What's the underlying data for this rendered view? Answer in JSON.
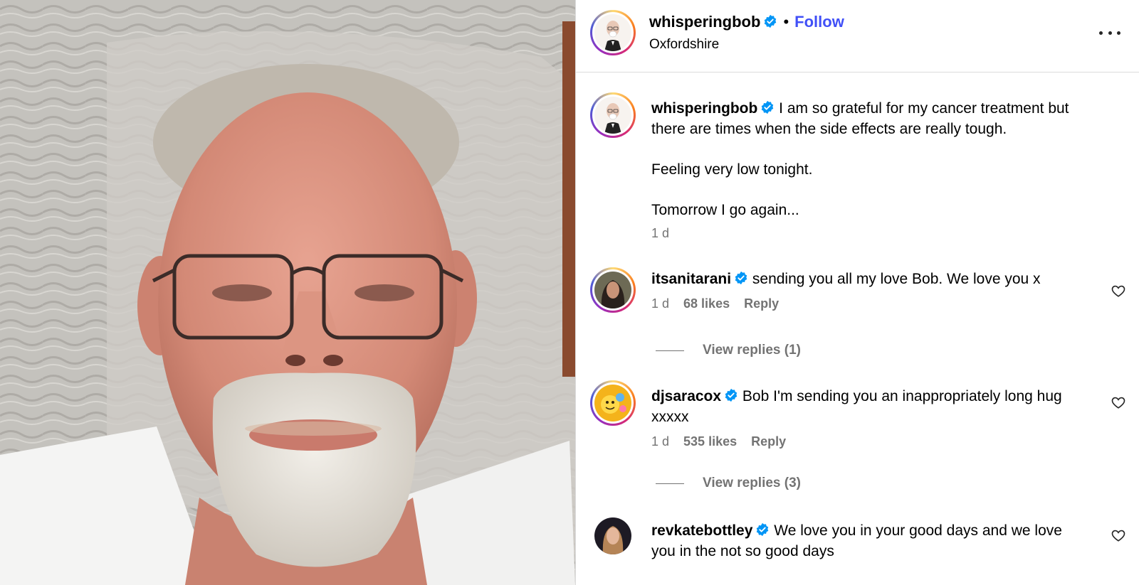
{
  "post": {
    "author": "whisperingbob",
    "follow_label": "Follow",
    "separator": "•",
    "location": "Oxfordshire",
    "caption": {
      "username": "whisperingbob",
      "line1": "I am so grateful for my cancer treatment but there are times when the side effects are really tough.",
      "line2": "Feeling very low tonight.",
      "line3": "Tomorrow I go again...",
      "time": "1 d"
    }
  },
  "comments": [
    {
      "username": "itsanitarani",
      "text": "sending you all my love Bob. We love you x",
      "time": "1 d",
      "likes": "68 likes",
      "reply_label": "Reply",
      "view_replies": "View replies (1)"
    },
    {
      "username": "djsaracox",
      "text": "Bob I'm sending you an inappropriately long hug xxxxx",
      "time": "1 d",
      "likes": "535 likes",
      "reply_label": "Reply",
      "view_replies": "View replies (3)"
    },
    {
      "username": "revkatebottley",
      "text": "We love you in your good days and we love you in the not so good days"
    }
  ],
  "icons": {
    "verified": "verified-badge-icon",
    "more": "more-options-icon",
    "like": "heart-icon"
  },
  "colors": {
    "follow": "#4150f7",
    "verified": "#0095f6",
    "meta": "#737373"
  }
}
